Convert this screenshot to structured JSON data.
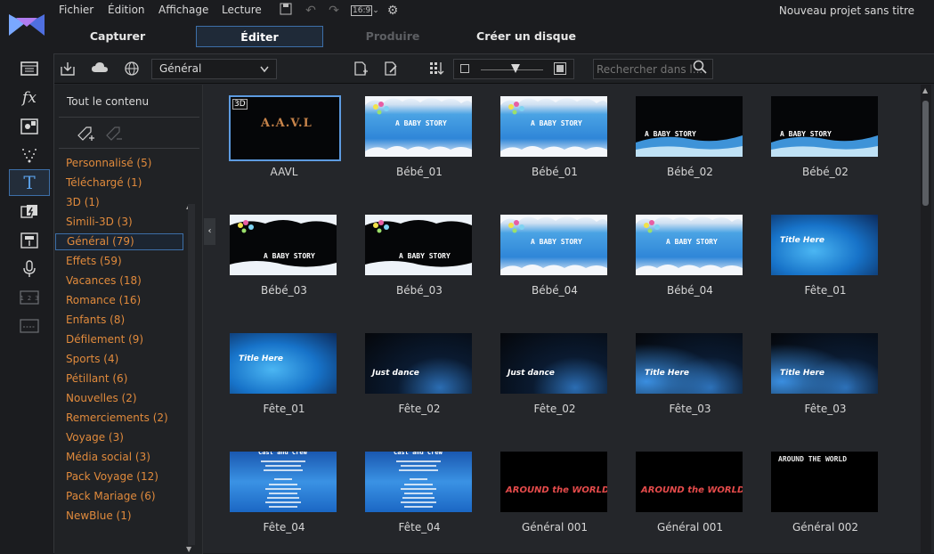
{
  "menu": [
    "Fichier",
    "Édition",
    "Affichage",
    "Lecture"
  ],
  "aspect_ratio": "16:9",
  "project_title": "Nouveau projet sans titre",
  "modes": [
    {
      "label": "Capturer",
      "state": "normal"
    },
    {
      "label": "Éditer",
      "state": "active"
    },
    {
      "label": "Produire",
      "state": "disabled"
    },
    {
      "label": "Créer un disque",
      "state": "normal"
    }
  ],
  "tools": [
    "media-room-icon",
    "fx-icon",
    "pip-icon",
    "particle-icon",
    "title-icon",
    "transition-icon",
    "audio-mixing-icon",
    "voiceover-icon",
    "chapter-icon",
    "subtitle-icon"
  ],
  "room": {
    "category": "Général",
    "search_placeholder": "Rechercher dans l...",
    "zoom_level": 0.4
  },
  "sidebar": {
    "all_content": "Tout le contenu",
    "categories": [
      "Personnalisé  (5)",
      "Téléchargé  (1)",
      "3D  (1)",
      "Simili-3D  (3)",
      "Général  (79)",
      "Effets  (59)",
      "Vacances  (18)",
      "Romance  (16)",
      "Enfants  (8)",
      "Défilement  (9)",
      "Sports  (4)",
      "Pétillant  (6)",
      "Nouvelles  (2)",
      "Remerciements  (2)",
      "Voyage  (3)",
      "Média social  (3)",
      "Pack Voyage  (12)",
      "Pack Mariage  (6)",
      "NewBlue  (1)"
    ],
    "selected_index": 4
  },
  "templates": [
    {
      "label": "AAVL",
      "style": "aavl",
      "thumb_text": "A.A.V.L",
      "badge": "3D"
    },
    {
      "label": "Bébé_01",
      "style": "baby",
      "thumb_text": "A BABY STORY"
    },
    {
      "label": "Bébé_01",
      "style": "baby",
      "thumb_text": "A BABY STORY"
    },
    {
      "label": "Bébé_02",
      "style": "baby-dark",
      "thumb_text": "A BABY STORY"
    },
    {
      "label": "Bébé_02",
      "style": "baby-dark",
      "thumb_text": "A BABY STORY"
    },
    {
      "label": "Bébé_03",
      "style": "baby-dark2",
      "thumb_text": "A BABY STORY"
    },
    {
      "label": "Bébé_03",
      "style": "baby-dark2",
      "thumb_text": "A BABY STORY"
    },
    {
      "label": "Bébé_04",
      "style": "baby4",
      "thumb_text": "A BABY STORY"
    },
    {
      "label": "Bébé_04",
      "style": "baby4",
      "thumb_text": "A BABY STORY"
    },
    {
      "label": "Fête_01",
      "style": "fete",
      "thumb_text": "Title Here"
    },
    {
      "label": "Fête_01",
      "style": "fete",
      "thumb_text": "Title Here"
    },
    {
      "label": "Fête_02",
      "style": "fete2",
      "thumb_text": "Just dance"
    },
    {
      "label": "Fête_02",
      "style": "fete2",
      "thumb_text": "Just dance"
    },
    {
      "label": "Fête_03",
      "style": "fete3",
      "thumb_text": "Title Here"
    },
    {
      "label": "Fête_03",
      "style": "fete3",
      "thumb_text": "Title Here"
    },
    {
      "label": "Fête_04",
      "style": "credits",
      "thumb_text": "Cast and Crew"
    },
    {
      "label": "Fête_04",
      "style": "credits",
      "thumb_text": "Cast and Crew"
    },
    {
      "label": "Général 001",
      "style": "world",
      "thumb_text": "AROUND the WORLD"
    },
    {
      "label": "Général 001",
      "style": "world",
      "thumb_text": "AROUND the WORLD"
    },
    {
      "label": "Général 002",
      "style": "world2",
      "thumb_text": "AROUND THE WORLD"
    }
  ],
  "selected_template": 0
}
